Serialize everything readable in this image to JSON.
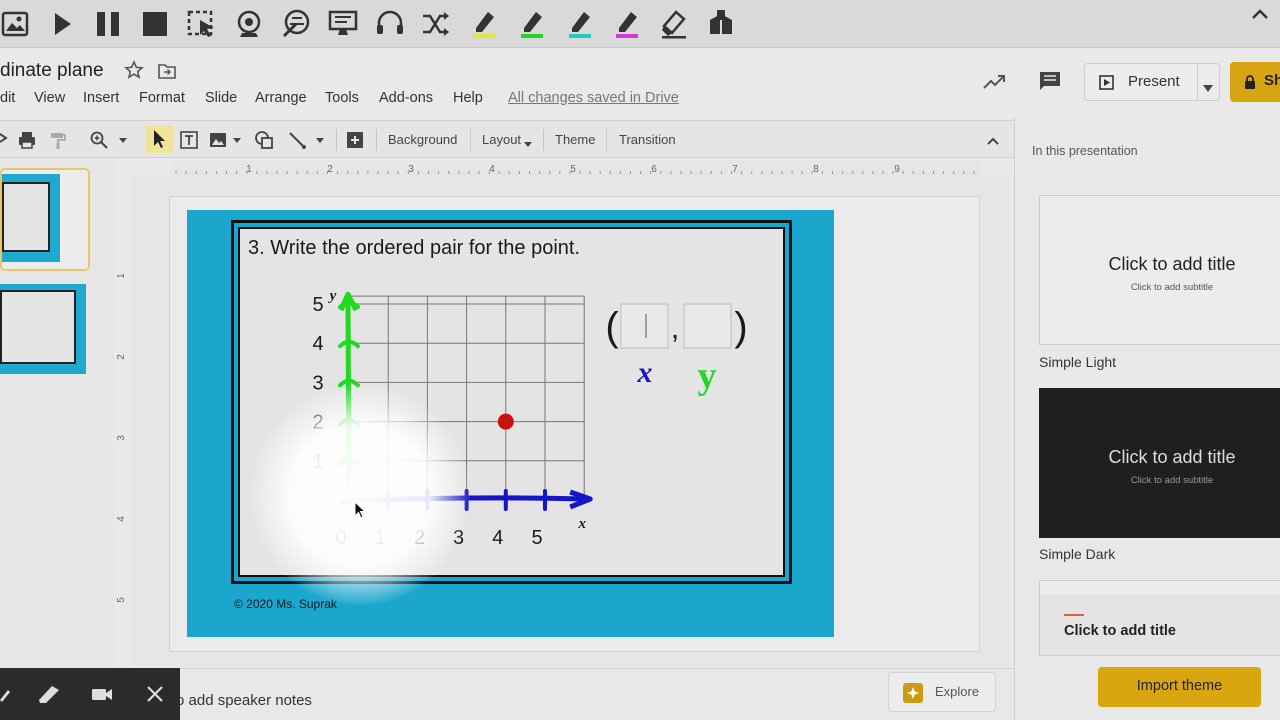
{
  "document": {
    "title": "dinate plane",
    "menu": [
      "dit",
      "View",
      "Insert",
      "Format",
      "Slide",
      "Arrange",
      "Tools",
      "Add-ons",
      "Help"
    ],
    "saved_status": "All changes saved in Drive"
  },
  "header": {
    "present_label": "Present",
    "share_label": "Sh"
  },
  "toolbar": {
    "background_label": "Background",
    "layout_label": "Layout",
    "theme_label": "Theme",
    "transition_label": "Transition"
  },
  "ruler": {
    "top_ticks": [
      "1",
      "2",
      "3",
      "4",
      "5",
      "6",
      "7",
      "8",
      "9"
    ],
    "left_ticks": [
      "1",
      "2",
      "3",
      "4",
      "5"
    ]
  },
  "slide": {
    "heading": "3. Write the ordered pair for the point.",
    "copyright": "© 2020 Ms. Suprak",
    "x_axis_label": "x",
    "y_axis_label": "y",
    "x_ticks": [
      "0",
      "1",
      "2",
      "3",
      "4",
      "5"
    ],
    "y_ticks": [
      "1",
      "2",
      "3",
      "4",
      "5"
    ],
    "point": {
      "x": 4,
      "y": 2
    },
    "ordered_pair_open": "(",
    "ordered_pair_comma": ",",
    "ordered_pair_close": ")",
    "handwritten_x": "x",
    "handwritten_y": "y",
    "colors": {
      "slide_bg": "#1ba6ce",
      "x_axis": "#1515c8",
      "y_axis": "#22d822",
      "point": "#cc1111"
    }
  },
  "notes": {
    "placeholder": "o add speaker notes"
  },
  "explore": {
    "label": "Explore"
  },
  "themes": {
    "heading": "In this presentation",
    "cards": [
      {
        "name": "Simple Light",
        "title": "Click to add title",
        "subtitle": "Click to add subtitle"
      },
      {
        "name": "Simple Dark",
        "title": "Click to add title",
        "subtitle": "Click to add subtitle"
      },
      {
        "name": "",
        "title": "Click to add title",
        "subtitle": ""
      }
    ],
    "import_label": "Import theme"
  },
  "recorder_toolbar": {
    "icons": [
      "image-icon",
      "play-icon",
      "pause-icon",
      "stop-icon",
      "region-select-icon",
      "webcam-icon",
      "annotate-icon",
      "monitor-icon",
      "headset-icon",
      "shuffle-icon",
      "highlighter-yellow-icon",
      "highlighter-green-icon",
      "highlighter-teal-icon",
      "highlighter-magenta-icon",
      "eraser-icon",
      "package-icon"
    ],
    "highlighter_colors": [
      "#e5e537",
      "#2bd12b",
      "#1ec8c0",
      "#d23ad6"
    ]
  },
  "recorder_panel": {
    "icons": [
      "pen-icon",
      "marker-icon",
      "camera-icon",
      "close-icon"
    ]
  }
}
